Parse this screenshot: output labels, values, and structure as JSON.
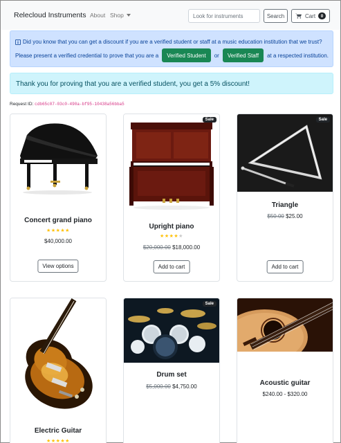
{
  "navbar": {
    "brand": "Relecloud Instruments",
    "about_label": "About",
    "shop_label": "Shop",
    "search_placeholder": "Look for instruments",
    "search_button": "Search",
    "cart_label": "Cart",
    "cart_count": "0"
  },
  "discount_alert": {
    "line1": "Did you know that you can get a discount if you are a verified student or staff at a music education institution that we trust?",
    "line2_prefix": "Please present a verified credential to prove that you are a",
    "verified_student_button": "Verified Student",
    "or_text": "or",
    "verified_staff_button": "Verified Staff",
    "line2_suffix": "at a respected institution."
  },
  "success_alert": {
    "text": "Thank you for proving that you are a verified student, you get a 5% discount!"
  },
  "request": {
    "label": "Request ID:",
    "id": "cdb65c07-03c0-490a-bf95-10438a56bba5"
  },
  "products": [
    {
      "name": "Concert grand piano",
      "rating": 5,
      "price": "$40,000.00",
      "old_price": "",
      "sale": false,
      "sale_label": "",
      "button": "View options",
      "image": "grand-piano"
    },
    {
      "name": "Upright piano",
      "rating": 4,
      "price": "$18,000.00",
      "old_price": "$20,000.00",
      "sale": true,
      "sale_label": "Sale",
      "button": "Add to cart",
      "image": "upright-piano"
    },
    {
      "name": "Triangle",
      "rating": 0,
      "price": "$25.00",
      "old_price": "$50.00",
      "sale": true,
      "sale_label": "Sale",
      "button": "Add to cart",
      "image": "triangle"
    },
    {
      "name": "Electric Guitar",
      "rating": 5,
      "price": "",
      "old_price": "",
      "sale": false,
      "sale_label": "",
      "button": "",
      "image": "electric-guitar"
    },
    {
      "name": "Drum set",
      "rating": 0,
      "price": "$4,750.00",
      "old_price": "$5,000.00",
      "sale": true,
      "sale_label": "Sale",
      "button": "",
      "image": "drum-set"
    },
    {
      "name": "Acoustic guitar",
      "rating": 0,
      "price": "$240.00 - $320.00",
      "old_price": "",
      "sale": false,
      "sale_label": "",
      "button": "",
      "image": "acoustic-guitar"
    }
  ],
  "colors": {
    "success": "#198754",
    "star": "#ffc107",
    "primary_alert_bg": "#cfe2ff",
    "info_alert_bg": "#cff4fc"
  }
}
